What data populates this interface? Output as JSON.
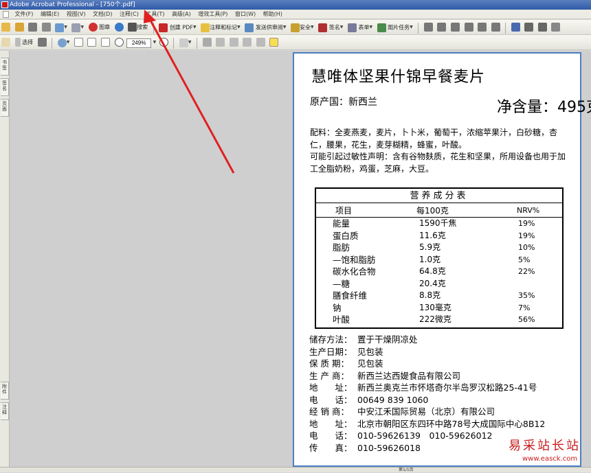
{
  "window": {
    "title": "Adobe Acrobat Professional - [750个.pdf]"
  },
  "menu": [
    "文件(F)",
    "编辑(E)",
    "视图(V)",
    "文档(D)",
    "注释(C)",
    "工具(T)",
    "高级(A)",
    "增效工具(P)",
    "窗口(W)",
    "帮助(H)"
  ],
  "toolbar1": {
    "scan": "图章",
    "search": "搜索",
    "create_pdf": "创建 PDF",
    "comment": "注释和标记",
    "send_review": "发送供审阅",
    "secure": "安全",
    "sign": "签名",
    "forms": "表单",
    "picture_tasks": "图片任务"
  },
  "toolbar2": {
    "select": "选择",
    "zoom": "249%"
  },
  "left_tabs": [
    "书签",
    "签名",
    "页面",
    "附件",
    "注释"
  ],
  "status": {
    "page_indicator": "第1/1页"
  },
  "document": {
    "title": "慧唯体坚果什锦早餐麦片",
    "origin": "原产国：新西兰",
    "net_weight": "净含量：495克",
    "ingredients": "配料：全麦燕麦，麦片，卜卜米，葡萄干，浓缩苹果汁，白砂糖，杏仁，腰果，花生，麦芽糊精，蜂蜜，叶酸。",
    "allergen": "可能引起过敏性声明：含有谷物麸质，花生和坚果，所用设备也用于加工全脂奶粉，鸡蛋，芝麻，大豆。",
    "nutrition": {
      "title": "营养成分表",
      "headers": [
        "项目",
        "每100克",
        "NRV%"
      ],
      "rows": [
        [
          "能量",
          "1590千焦",
          "19%"
        ],
        [
          "蛋白质",
          "11.6克",
          "19%"
        ],
        [
          "脂肪",
          "5.9克",
          "10%"
        ],
        [
          "—饱和脂肪",
          "1.0克",
          "5%"
        ],
        [
          "碳水化合物",
          "64.8克",
          "22%"
        ],
        [
          "—糖",
          "20.4克",
          ""
        ],
        [
          "膳食纤维",
          "8.8克",
          "35%"
        ],
        [
          "钠",
          "130毫克",
          "7%"
        ],
        [
          "叶酸",
          "222微克",
          "56%"
        ]
      ]
    },
    "info": [
      {
        "k": "储存方法：",
        "v": "置于干燥阴凉处"
      },
      {
        "k": "生产日期：",
        "v": "见包装"
      },
      {
        "k": "保 质 期：",
        "v": "见包装"
      },
      {
        "k": "生 产 商：",
        "v": "新西兰达西媞食品有限公司"
      },
      {
        "k": "地　　址：",
        "v": "新西兰奥克兰市怀塔奇尔半岛罗汉松路25-41号"
      },
      {
        "k": "电　　话：",
        "v": "00649 839 1060"
      },
      {
        "k": "经 销 商：",
        "v": "中安江禾国际贸易（北京）有限公司"
      },
      {
        "k": "地　　址：",
        "v": "北京市朝阳区东四环中路78号大成国际中心8B12"
      },
      {
        "k": "电　　话：",
        "v": "010-59626139　010-59626012"
      },
      {
        "k": "传　　真：",
        "v": "010-59626018"
      }
    ]
  },
  "watermark": {
    "cn": "易采站长站",
    "en": "www.easck.com"
  },
  "colors": {
    "arrow": "#e02020",
    "page_border": "#4a7fc0"
  }
}
